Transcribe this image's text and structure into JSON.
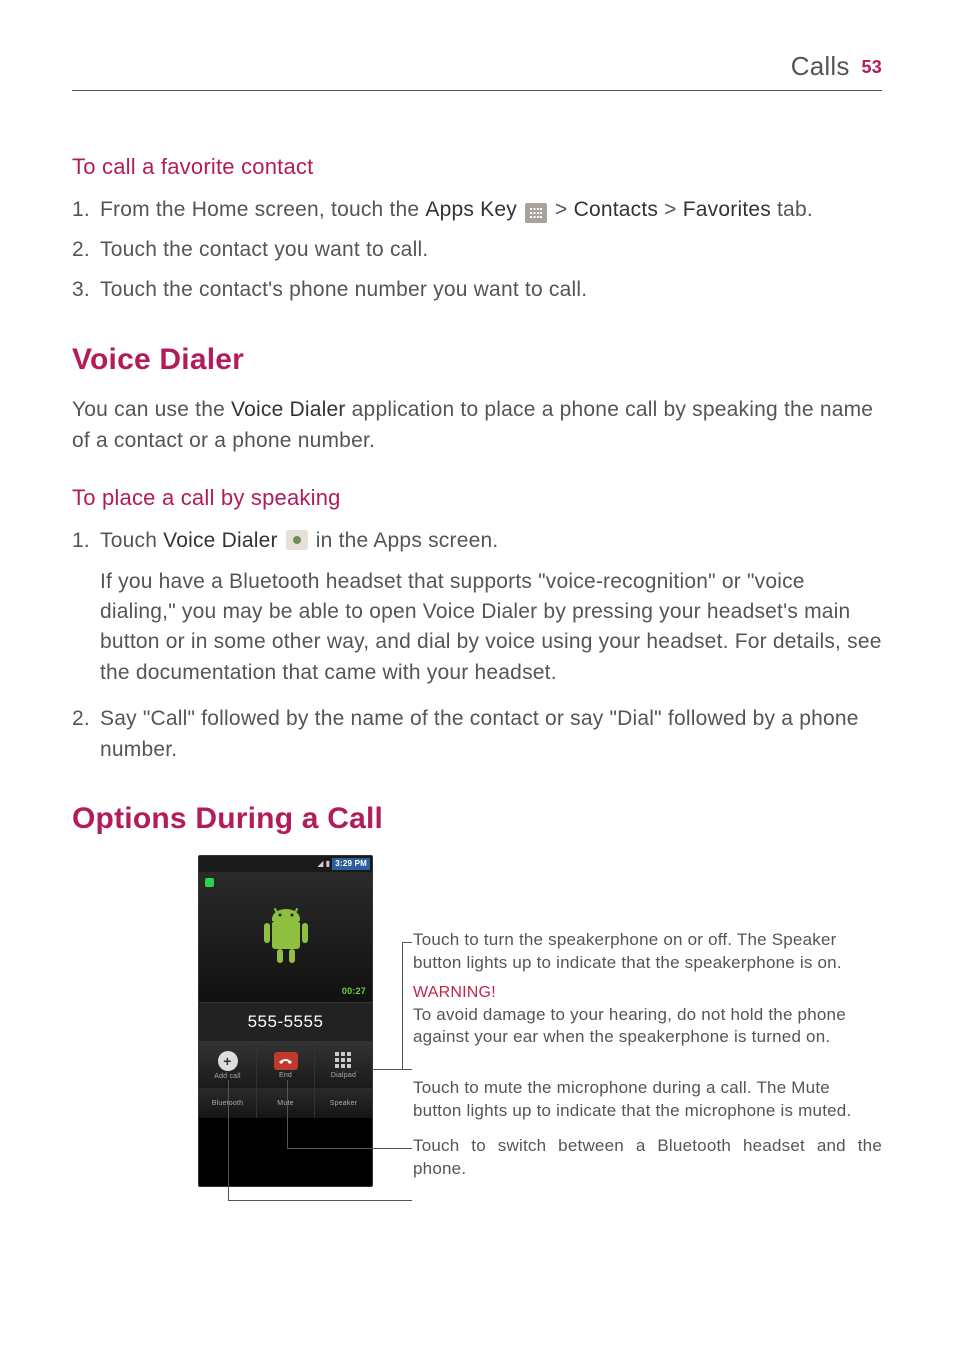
{
  "header": {
    "section": "Calls",
    "page_number": "53"
  },
  "sub1": {
    "title": "To call a favorite contact",
    "items": [
      {
        "num": "1.",
        "pre": "From the Home screen, touch the ",
        "bold1": "Apps Key",
        "mid1": " > ",
        "bold2": "Contacts",
        "mid2": " > ",
        "bold3": "Favorites",
        "post": " tab."
      },
      {
        "num": "2.",
        "text": "Touch the contact you want to call."
      },
      {
        "num": "3.",
        "text": "Touch the contact's phone number you want to call."
      }
    ]
  },
  "voice_dialer": {
    "title": "Voice Dialer",
    "intro_pre": "You can use the ",
    "intro_bold": "Voice Dialer",
    "intro_post": " application to place a phone call by speaking the name of a contact or a phone number."
  },
  "sub2": {
    "title": "To place a call by speaking",
    "item1_num": "1.",
    "item1_pre": "Touch ",
    "item1_bold": "Voice Dialer",
    "item1_post": " in the Apps screen.",
    "item1_detail": "If you have a Bluetooth headset that supports \"voice-recognition\" or \"voice dialing,\" you may be able to open Voice Dialer by pressing your headset's main button or in some other way, and dial by voice using your headset. For details, see the documentation that came with your headset.",
    "item2_num": "2.",
    "item2_text": "Say \"Call\" followed by the name of the contact or say \"Dial\" followed by a phone number."
  },
  "options": {
    "title": "Options During a Call"
  },
  "phone": {
    "status_time": "3:29 PM",
    "call_timer": "00:27",
    "dialed_number": "555-5555",
    "btn_addcall": "Add call",
    "btn_end": "End",
    "btn_dialpad": "Dialpad",
    "btn_bluetooth": "Bluetooth",
    "btn_mute": "Mute",
    "btn_speaker": "Speaker"
  },
  "annotations": {
    "speaker": "Touch to turn the speakerphone on or off. The Speaker button lights up to indicate that the speakerphone is on.",
    "warn_title": "WARNING!",
    "warn_text": "To avoid damage to your hearing, do not hold the phone against your ear when the speakerphone is turned on.",
    "mute": "Touch to mute the microphone during a call. The Mute button lights up to indicate that the microphone is muted.",
    "bluetooth": "Touch to switch between a Bluetooth headset and the phone."
  }
}
